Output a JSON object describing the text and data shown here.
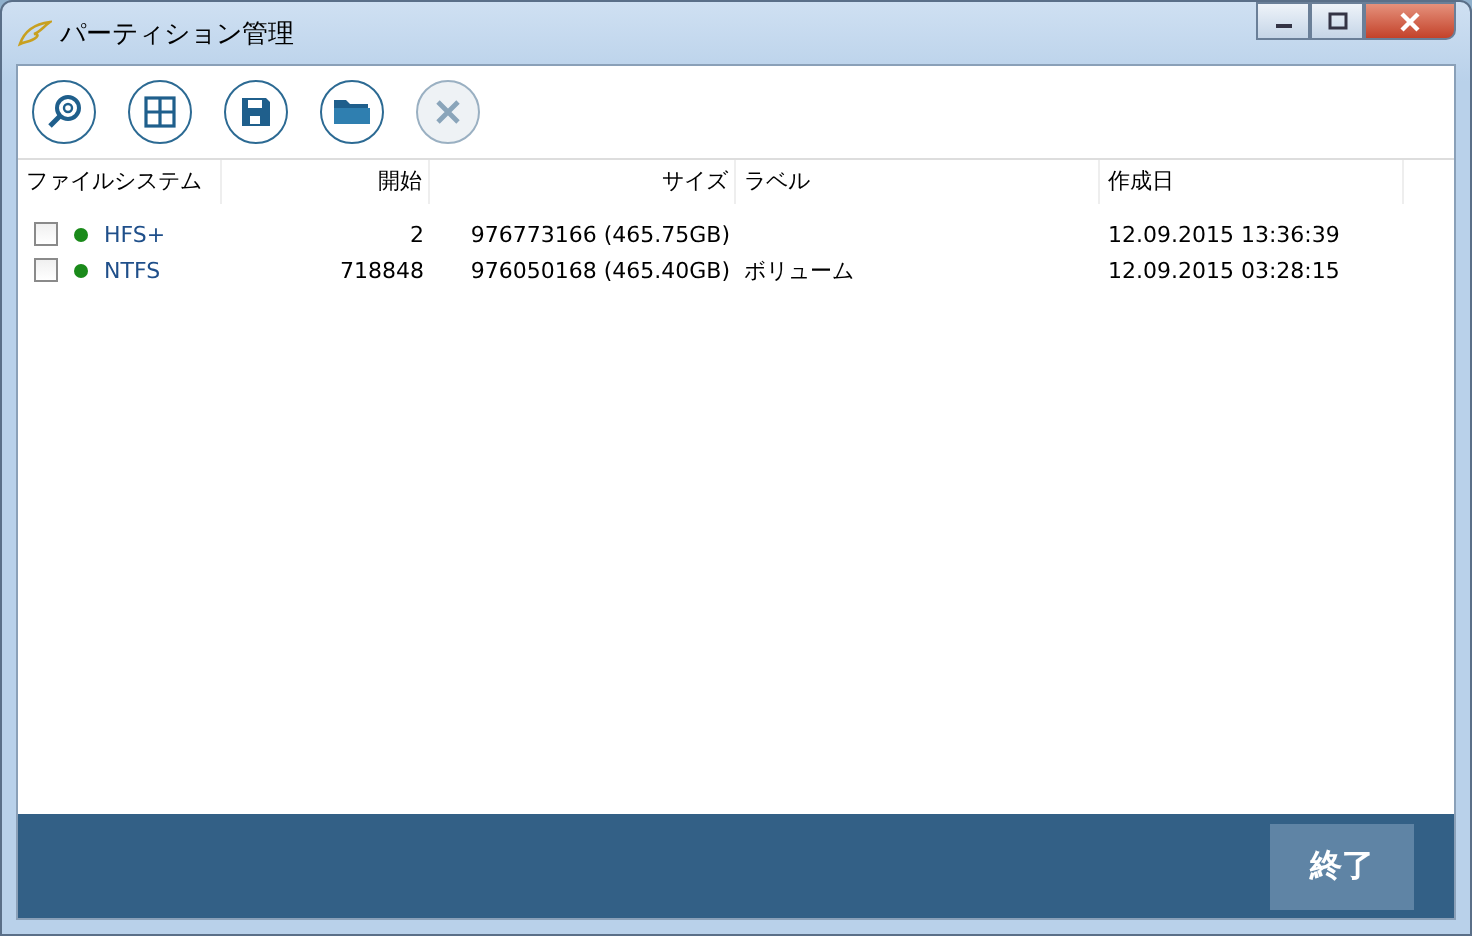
{
  "window": {
    "title": "パーティション管理"
  },
  "toolbar": [
    {
      "kind": "search",
      "disabled": false
    },
    {
      "kind": "grid",
      "disabled": false
    },
    {
      "kind": "save",
      "disabled": false
    },
    {
      "kind": "folder",
      "disabled": false
    },
    {
      "kind": "delete",
      "disabled": true
    }
  ],
  "table": {
    "columns": [
      "ファイルシステム",
      "開始",
      "サイズ",
      "ラベル",
      "作成日"
    ],
    "rows": [
      {
        "checked": false,
        "color": "#1a8a1a",
        "cells": [
          "HFS+",
          "2",
          "976773166 (465.75GB)",
          "",
          "12.09.2015 13:36:39"
        ]
      },
      {
        "checked": false,
        "color": "#1a8a1a",
        "cells": [
          "NTFS",
          "718848",
          "976050168 (465.40GB)",
          "ボリューム",
          "12.09.2015 03:28:15"
        ]
      }
    ]
  },
  "footer": {
    "button": "終了"
  }
}
